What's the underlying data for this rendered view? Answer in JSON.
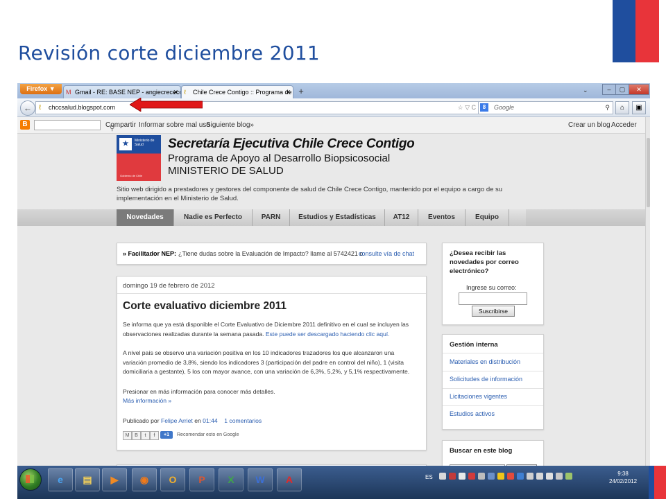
{
  "slide": {
    "title": "Revisión corte diciembre 2011"
  },
  "browser": {
    "app_button": "Firefox ▼",
    "tabs": [
      {
        "label": "Gmail - RE: BASE NEP - angiecrececo...",
        "icon": "gmail-icon"
      },
      {
        "label": "Chile Crece Contigo :: Programa de A...",
        "icon": "blog-favicon"
      }
    ],
    "url": "chccsalud.blogspot.com",
    "search_placeholder": "Google"
  },
  "bloggerbar": {
    "share": "Compartir",
    "report": "Informar sobre mal uso",
    "next": "Siguiente blog»",
    "create": "Crear un blog",
    "login": "Acceder"
  },
  "header": {
    "logo_ministry": "Ministerio de Salud",
    "logo_gov": "Gobierno de Chile",
    "title": "Secretaría Ejecutiva Chile Crece Contigo",
    "subtitle1": "Programa de Apoyo al Desarrollo Biopsicosocial",
    "subtitle2": "MINISTERIO DE SALUD",
    "description": "Sitio web dirigido a prestadores y gestores del componente de salud de Chile Crece Contigo, mantenido por el equipo a cargo de su implementación en el Ministerio de Salud."
  },
  "nav": [
    {
      "label": "Novedades",
      "active": true
    },
    {
      "label": "Nadie es Perfecto",
      "active": false
    },
    {
      "label": "PARN",
      "active": false
    },
    {
      "label": "Estudios y Estadísticas",
      "active": false
    },
    {
      "label": "AT12",
      "active": false
    },
    {
      "label": "Eventos",
      "active": false
    },
    {
      "label": "Equipo",
      "active": false
    }
  ],
  "facilitator": {
    "prefix": "» Facilitador NEP:",
    "text": "¿Tiene dudas sobre la Evaluación de Impacto? llame al 5742421 o",
    "link": "consulte vía de chat"
  },
  "post": {
    "date": "domingo 19 de febrero de 2012",
    "title": "Corte evaluativo diciembre 2011",
    "p1": "Se informa que ya está disponible el Corte Evaluativo de Diciembre 2011 definitivo en el cual se incluyen las observaciones realizadas durante la semana pasada.",
    "p1_link": "Este puede ser descargado haciendo clic aquí.",
    "p2": "A nivel país se observo una variación positiva en los 10 indicadores trazadores los que alcanzaron una variación promedio de 3,8%, siendo los indicadores 3 (participación del padre en control del niño), 1 (visita domiciliaria a gestante), 5 los con mayor avance, con una variación de 6,3%, 5,2%, y 5,1% respectivamente.",
    "p3": "Presionar en más información para conocer más detalles.",
    "more": "Más información »",
    "by_prefix": "Publicado por",
    "author": "Felipe Arriet",
    "at": "en",
    "time": "01:44",
    "comments": "1 comentarios",
    "plus_one": "+1",
    "recommend": "Recomendar esto en Google"
  },
  "sidebar": {
    "subscribe_title": "¿Desea recibir las novedades por correo electrónico?",
    "email_label": "Ingrese su correo:",
    "subscribe_button": "Suscribirse",
    "gestion_title": "Gestión interna",
    "gestion_links": [
      "Materiales en distribución",
      "Solicitudes de información",
      "Licitaciones vigentes",
      "Estudios activos"
    ],
    "search_title": "Buscar en este blog"
  },
  "taskbar": {
    "apps": [
      {
        "name": "ie",
        "glyph": "e"
      },
      {
        "name": "explorer",
        "glyph": "▤"
      },
      {
        "name": "media-player",
        "glyph": "▶"
      },
      {
        "name": "firefox",
        "glyph": "◉"
      },
      {
        "name": "outlook",
        "glyph": "O"
      },
      {
        "name": "powerpoint",
        "glyph": "P"
      },
      {
        "name": "excel",
        "glyph": "X"
      },
      {
        "name": "word",
        "glyph": "W"
      },
      {
        "name": "acrobat",
        "glyph": "A"
      }
    ],
    "lang": "ES",
    "time": "9:38",
    "date": "24/02/2012"
  }
}
